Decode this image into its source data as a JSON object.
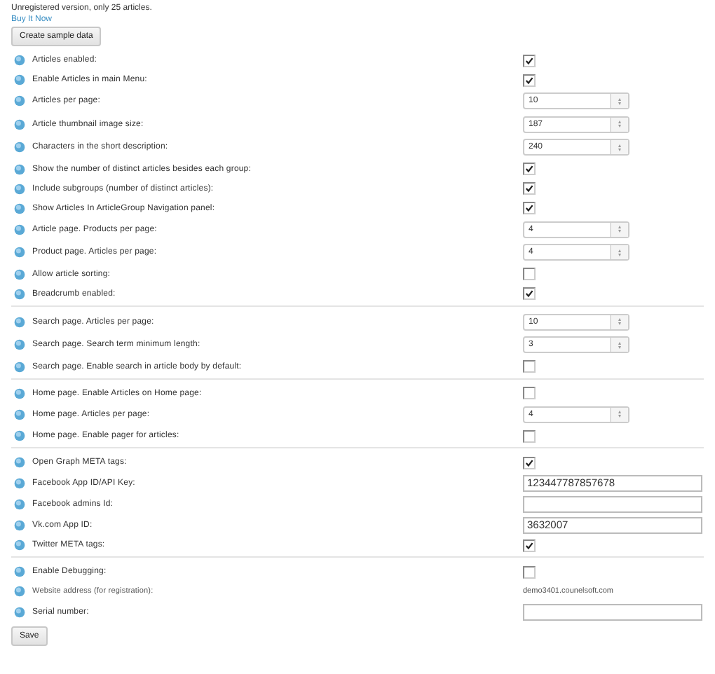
{
  "notice": "Unregistered version, only 25 articles.",
  "buy_link": "Buy It Now",
  "sample_button": "Create sample data",
  "sections": [
    [
      {
        "label": "Articles enabled:",
        "kind": "checkbox",
        "checked": true
      },
      {
        "label": "Enable Articles in main Menu:",
        "kind": "checkbox",
        "checked": true
      },
      {
        "label": "Articles per page:",
        "kind": "spinner",
        "value": "10"
      },
      {
        "label": "Article thumbnail image size:",
        "kind": "spinner",
        "value": "187"
      },
      {
        "label": "Characters in the short description:",
        "kind": "spinner",
        "value": "240"
      },
      {
        "label": "Show the number of distinct articles besides each group:",
        "kind": "checkbox",
        "checked": true
      },
      {
        "label": "Include subgroups (number of distinct articles):",
        "kind": "checkbox",
        "checked": true
      },
      {
        "label": "Show Articles In ArticleGroup Navigation panel:",
        "kind": "checkbox",
        "checked": true
      },
      {
        "label": "Article page. Products per page:",
        "kind": "spinner",
        "value": "4"
      },
      {
        "label": "Product page. Articles per page:",
        "kind": "spinner",
        "value": "4"
      },
      {
        "label": "Allow article sorting:",
        "kind": "checkbox",
        "checked": false
      },
      {
        "label": "Breadcrumb enabled:",
        "kind": "checkbox",
        "checked": true
      }
    ],
    [
      {
        "label": "Search page. Articles per page:",
        "kind": "spinner",
        "value": "10"
      },
      {
        "label": "Search page. Search term minimum length:",
        "kind": "spinner",
        "value": "3"
      },
      {
        "label": "Search page. Enable search in article body by default:",
        "kind": "checkbox",
        "checked": false
      }
    ],
    [
      {
        "label": "Home page. Enable Articles on Home page:",
        "kind": "checkbox",
        "checked": false
      },
      {
        "label": "Home page. Articles per page:",
        "kind": "spinner",
        "value": "4"
      },
      {
        "label": "Home page. Enable pager for articles:",
        "kind": "checkbox",
        "checked": false
      }
    ],
    [
      {
        "label": "Open Graph META tags:",
        "kind": "checkbox",
        "checked": true
      },
      {
        "label": "Facebook App ID/API Key:",
        "kind": "text",
        "value": "123447787857678"
      },
      {
        "label": "Facebook admins Id:",
        "kind": "text"
      },
      {
        "label": "Vk.com App ID:",
        "kind": "text",
        "value": "3632007"
      },
      {
        "label": "Twitter META tags:",
        "kind": "checkbox",
        "checked": true
      }
    ],
    [
      {
        "label": "Enable Debugging:",
        "kind": "checkbox",
        "checked": false
      },
      {
        "label": "Website address (for registration):",
        "kind": "static",
        "value": "demo3401.counelsoft.com"
      },
      {
        "label": "Serial number:",
        "kind": "text"
      }
    ]
  ],
  "save_button": "Save"
}
